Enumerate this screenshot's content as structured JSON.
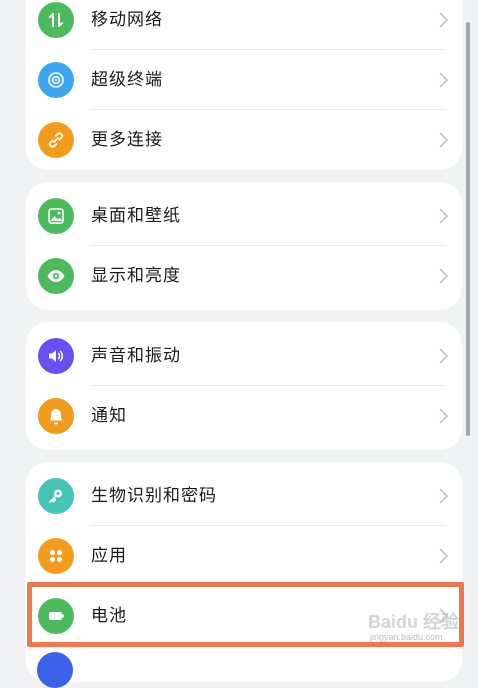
{
  "colors": {
    "background": "#f1f2f4",
    "card": "#ffffff",
    "highlight_border": "#f0764e"
  },
  "groups": [
    {
      "items": [
        {
          "label": "移动网络",
          "icon": "mobile-network-icon",
          "color": "#4cbb5e"
        },
        {
          "label": "超级终端",
          "icon": "super-device-icon",
          "color": "#3ea6f0"
        },
        {
          "label": "更多连接",
          "icon": "link-icon",
          "color": "#f39b1c"
        }
      ]
    },
    {
      "items": [
        {
          "label": "桌面和壁纸",
          "icon": "wallpaper-icon",
          "color": "#4cbb5e"
        },
        {
          "label": "显示和亮度",
          "icon": "eye-icon",
          "color": "#4cbb5e"
        }
      ]
    },
    {
      "items": [
        {
          "label": "声音和振动",
          "icon": "volume-icon",
          "color": "#6a4ff0"
        },
        {
          "label": "通知",
          "icon": "bell-icon",
          "color": "#f39b1c"
        }
      ]
    },
    {
      "items": [
        {
          "label": "生物识别和密码",
          "icon": "key-icon",
          "color": "#44c3b6"
        },
        {
          "label": "应用",
          "icon": "apps-icon",
          "color": "#f39b1c"
        },
        {
          "label": "电池",
          "icon": "battery-icon",
          "color": "#4cbb5e"
        }
      ]
    }
  ],
  "watermark": {
    "brand": "Baidu 经验",
    "url": "jingyan.baidu.com"
  }
}
